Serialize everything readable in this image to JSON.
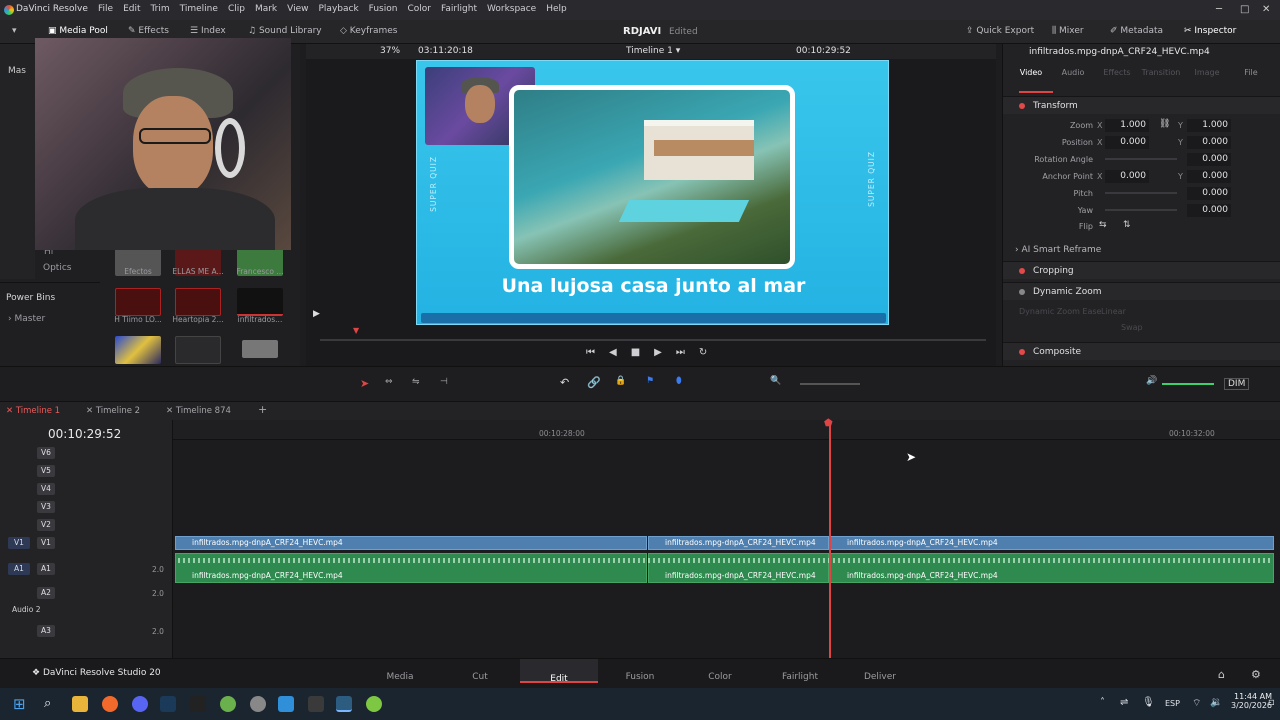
{
  "app": {
    "title": "DaVinci Resolve",
    "edition": "DaVinci Resolve Studio 20"
  },
  "menu": [
    "File",
    "Edit",
    "Trim",
    "Timeline",
    "Clip",
    "Mark",
    "View",
    "Playback",
    "Fusion",
    "Color",
    "Fairlight",
    "Workspace",
    "Help"
  ],
  "toolbar": {
    "media_pool": "Media Pool",
    "effects": "Effects",
    "index": "Index",
    "sound_library": "Sound Library",
    "keyframes": "Keyframes",
    "project_name": "RDJAVI",
    "project_status": "Edited",
    "quick_export": "Quick Export",
    "mixer": "Mixer",
    "metadata": "Metadata",
    "inspector": "Inspector"
  },
  "viewer": {
    "zoom": "37%",
    "source_tc": "03:11:20:18",
    "timeline_name": "Timeline 1",
    "record_tc": "00:10:29:52",
    "frame_caption": "Una lujosa casa junto al mar",
    "side_text": "SUPER QUIZ"
  },
  "media": {
    "left_labels": {
      "hi": "Hi",
      "optics": "Optics",
      "power_bins": "Power Bins",
      "master": "Master",
      "mas": "Mas"
    },
    "clips": [
      {
        "label": "Efectos"
      },
      {
        "label": "ELLAS ME A..."
      },
      {
        "label": "Francesco ..."
      },
      {
        "label": "H Tiimo LO..."
      },
      {
        "label": "Heartopia 2..."
      },
      {
        "label": "infiltrados..."
      }
    ]
  },
  "inspector": {
    "clip_name": "infiltrados.mpg-dnpA_CRF24_HEVC.mp4",
    "tabs": [
      "Video",
      "Audio",
      "Effects",
      "Transition",
      "Image",
      "File"
    ],
    "sections": {
      "transform": "Transform",
      "ai_reframe": "AI Smart Reframe",
      "cropping": "Cropping",
      "dynamic_zoom": "Dynamic Zoom",
      "composite": "Composite",
      "dz_ease_label": "Dynamic Zoom Ease",
      "dz_ease_value": "Linear",
      "swap": "Swap"
    },
    "params": {
      "zoom": "Zoom",
      "position": "Position",
      "rotation": "Rotation Angle",
      "anchor": "Anchor Point",
      "pitch": "Pitch",
      "yaw": "Yaw",
      "flip": "Flip",
      "zoom_x": "1.000",
      "zoom_y": "1.000",
      "pos_x": "0.000",
      "pos_y": "0.000",
      "rot": "0.000",
      "anc_x": "0.000",
      "anc_y": "0.000",
      "pitch_v": "0.000",
      "yaw_v": "0.000",
      "x": "X",
      "y": "Y"
    }
  },
  "timeline": {
    "tabs": [
      "Timeline 1",
      "Timeline 2",
      "Timeline 874"
    ],
    "timecode": "00:10:29:52",
    "ruler": [
      "00:10:28:00",
      "00:10:32:00"
    ],
    "video_tracks": [
      "V6",
      "V5",
      "V4",
      "V3",
      "V2",
      "V1"
    ],
    "audio_tracks": [
      {
        "id": "A1",
        "vol": "2.0"
      },
      {
        "id": "A2",
        "vol": "2.0"
      },
      {
        "id": "A3",
        "vol": "2.0"
      }
    ],
    "audio2_label": "Audio 2",
    "clip_name": "infiltrados.mpg-dnpA_CRF24_HEVC.mp4",
    "dim": "DIM"
  },
  "pages": [
    "Media",
    "Cut",
    "Edit",
    "Fusion",
    "Color",
    "Fairlight",
    "Deliver"
  ],
  "taskbar": {
    "lang": "ESP",
    "time": "11:44 AM",
    "date": "3/20/2026"
  }
}
